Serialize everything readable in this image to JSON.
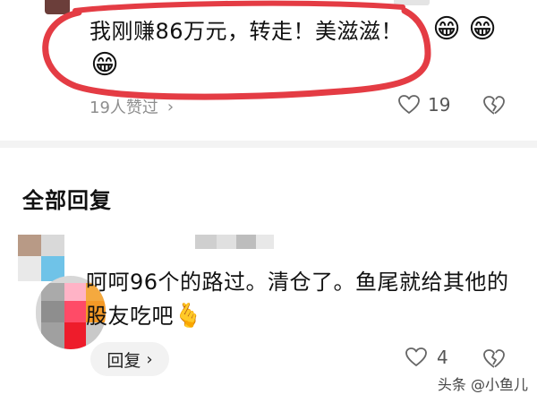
{
  "previous_comment": {
    "text": "我刚赚86万元，转走！美滋滋！",
    "emoji": "😁",
    "likers_label": "19人赞过",
    "like_count": "19"
  },
  "section_title": "全部回复",
  "reply": {
    "text": "呵呵96个的路过。清仓了。鱼尾就给其他的股友吃吧",
    "emoji": "🫰",
    "reply_button_label": "回复",
    "like_count": "4"
  },
  "watermark": {
    "text": "头条 @小鱼儿"
  },
  "colors": {
    "annotation_circle": "#e43c44",
    "muted_text": "#8e8e8e",
    "divider": "#f3f3f3",
    "button_bg": "#f2f2f2"
  }
}
